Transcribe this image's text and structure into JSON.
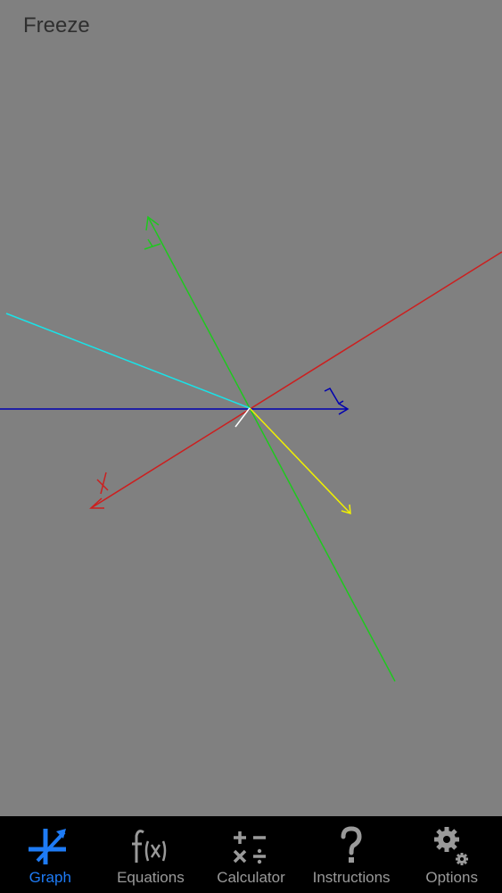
{
  "header": {
    "freeze_label": "Freeze"
  },
  "graph": {
    "background_color": "#808080",
    "axis_x_label": "x",
    "axis_y_label": "y",
    "axis_z_label": "z",
    "colors": {
      "x_axis": "#cc1f1f",
      "y_axis": "#1ec81e",
      "z_axis": "#0000b0",
      "cyan_vector": "#19e3e8",
      "yellow_vector": "#f0f000",
      "white_vector": "#ffffff"
    }
  },
  "tab_bar": {
    "active_color": "#1e7bf5",
    "inactive_color": "#9a9a9a",
    "tabs": [
      {
        "label": "Graph",
        "icon": "graph-icon",
        "active": true
      },
      {
        "label": "Equations",
        "icon": "fx-icon",
        "active": false
      },
      {
        "label": "Calculator",
        "icon": "calculator-icon",
        "active": false
      },
      {
        "label": "Instructions",
        "icon": "question-icon",
        "active": false
      },
      {
        "label": "Options",
        "icon": "gear-icon",
        "active": false
      }
    ]
  }
}
